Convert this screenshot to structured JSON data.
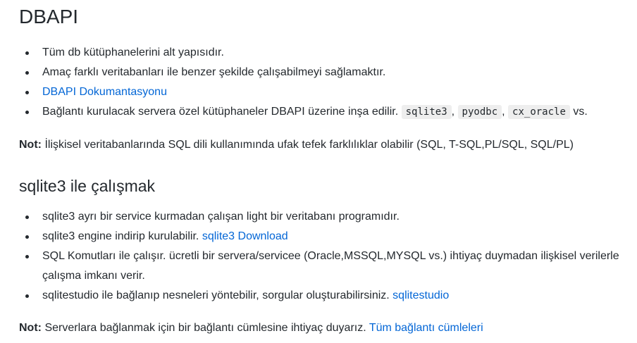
{
  "section1": {
    "title": "DBAPI",
    "items": [
      {
        "text": "Tüm db kütüphanelerini alt yapısıdır."
      },
      {
        "text": "Amaç farklı veritabanları ile benzer şekilde çalışabilmeyi sağlamaktır."
      },
      {
        "link": "DBAPI Dokumantasyonu"
      },
      {
        "text": "Bağlantı kurulacak servera özel kütüphaneler DBAPI üzerine inşa edilir.",
        "codes": [
          "sqlite3",
          "pyodbc",
          "cx_oracle"
        ],
        "sep": ",",
        "suffix": "vs."
      }
    ],
    "note_label": "Not:",
    "note_text": "İlişkisel veritabanlarında SQL dili kullanımında ufak tefek farklılıklar olabilir (SQL, T-SQL,PL/SQL, SQL/PL)"
  },
  "section2": {
    "title": "sqlite3 ile çalışmak",
    "items": [
      {
        "text": "sqlite3 ayrı bir service kurmadan çalışan light bir veritabanı programıdır."
      },
      {
        "text": "sqlite3 engine indirip kurulabilir.",
        "link": "sqlite3 Download"
      },
      {
        "text": "SQL Komutları ile çalışır. ücretli bir servera/servicee (Oracle,MSSQL,MYSQL vs.) ihtiyaç duymadan ilişkisel verilerle çalışma imkanı verir."
      },
      {
        "text": "sqlitestudio ile bağlanıp nesneleri yöntebilir, sorgular oluşturabilirsiniz.",
        "link": "sqlitestudio"
      }
    ],
    "note_label": "Not:",
    "note_text": "Serverlara bağlanmak için bir bağlantı cümlesine ihtiyaç duyarız.",
    "note_link": "Tüm bağlantı cümleleri"
  },
  "colors": {
    "text": "#24292e",
    "link": "#0366d6",
    "code_bg": "#eeeeee"
  }
}
